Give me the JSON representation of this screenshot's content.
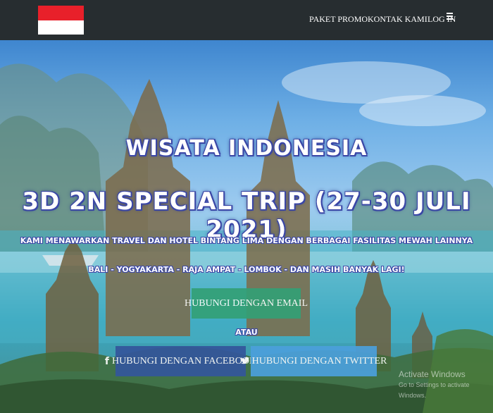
{
  "colors": {
    "navbar": "#272d30",
    "flag_top": "#e8202a",
    "flag_bottom": "#ffffff",
    "email_button": "#33a076",
    "facebook_button": "#34569c",
    "twitter_button": "#4ba0dc",
    "title_outline": "#3a46a6"
  },
  "nav": {
    "items": [
      {
        "label": "PAKET PROMO"
      },
      {
        "label": "KONTAK KAMI"
      },
      {
        "label": "LOG IN"
      }
    ],
    "menu_icon": "hamburger-icon"
  },
  "hero": {
    "title": "WISATA INDONESIA",
    "subtitle": "3D 2N SPECIAL TRIP (27-30 JULI 2021)",
    "tagline": "KAMI MENAWARKAN TRAVEL DAN HOTEL BINTANG LIMA DENGAN BERBAGAI FASILITAS MEWAH LAINNYA",
    "destinations": "BALI - YOGYAKARTA - RAJA AMPAT - LOMBOK - DAN MASIH BANYAK LAGI!",
    "email_button": "HUBUNGI DENGAN EMAIL",
    "or_text": "ATAU",
    "facebook_button": "HUBUNGI DENGAN FACEBOOK",
    "facebook_icon": "facebook-icon",
    "twitter_button": "HUBUNGI DENGAN TWITTER",
    "twitter_icon": "twitter-icon"
  },
  "watermark": {
    "line1": "Activate Windows",
    "line2": "Go to Settings to activate Windows."
  }
}
